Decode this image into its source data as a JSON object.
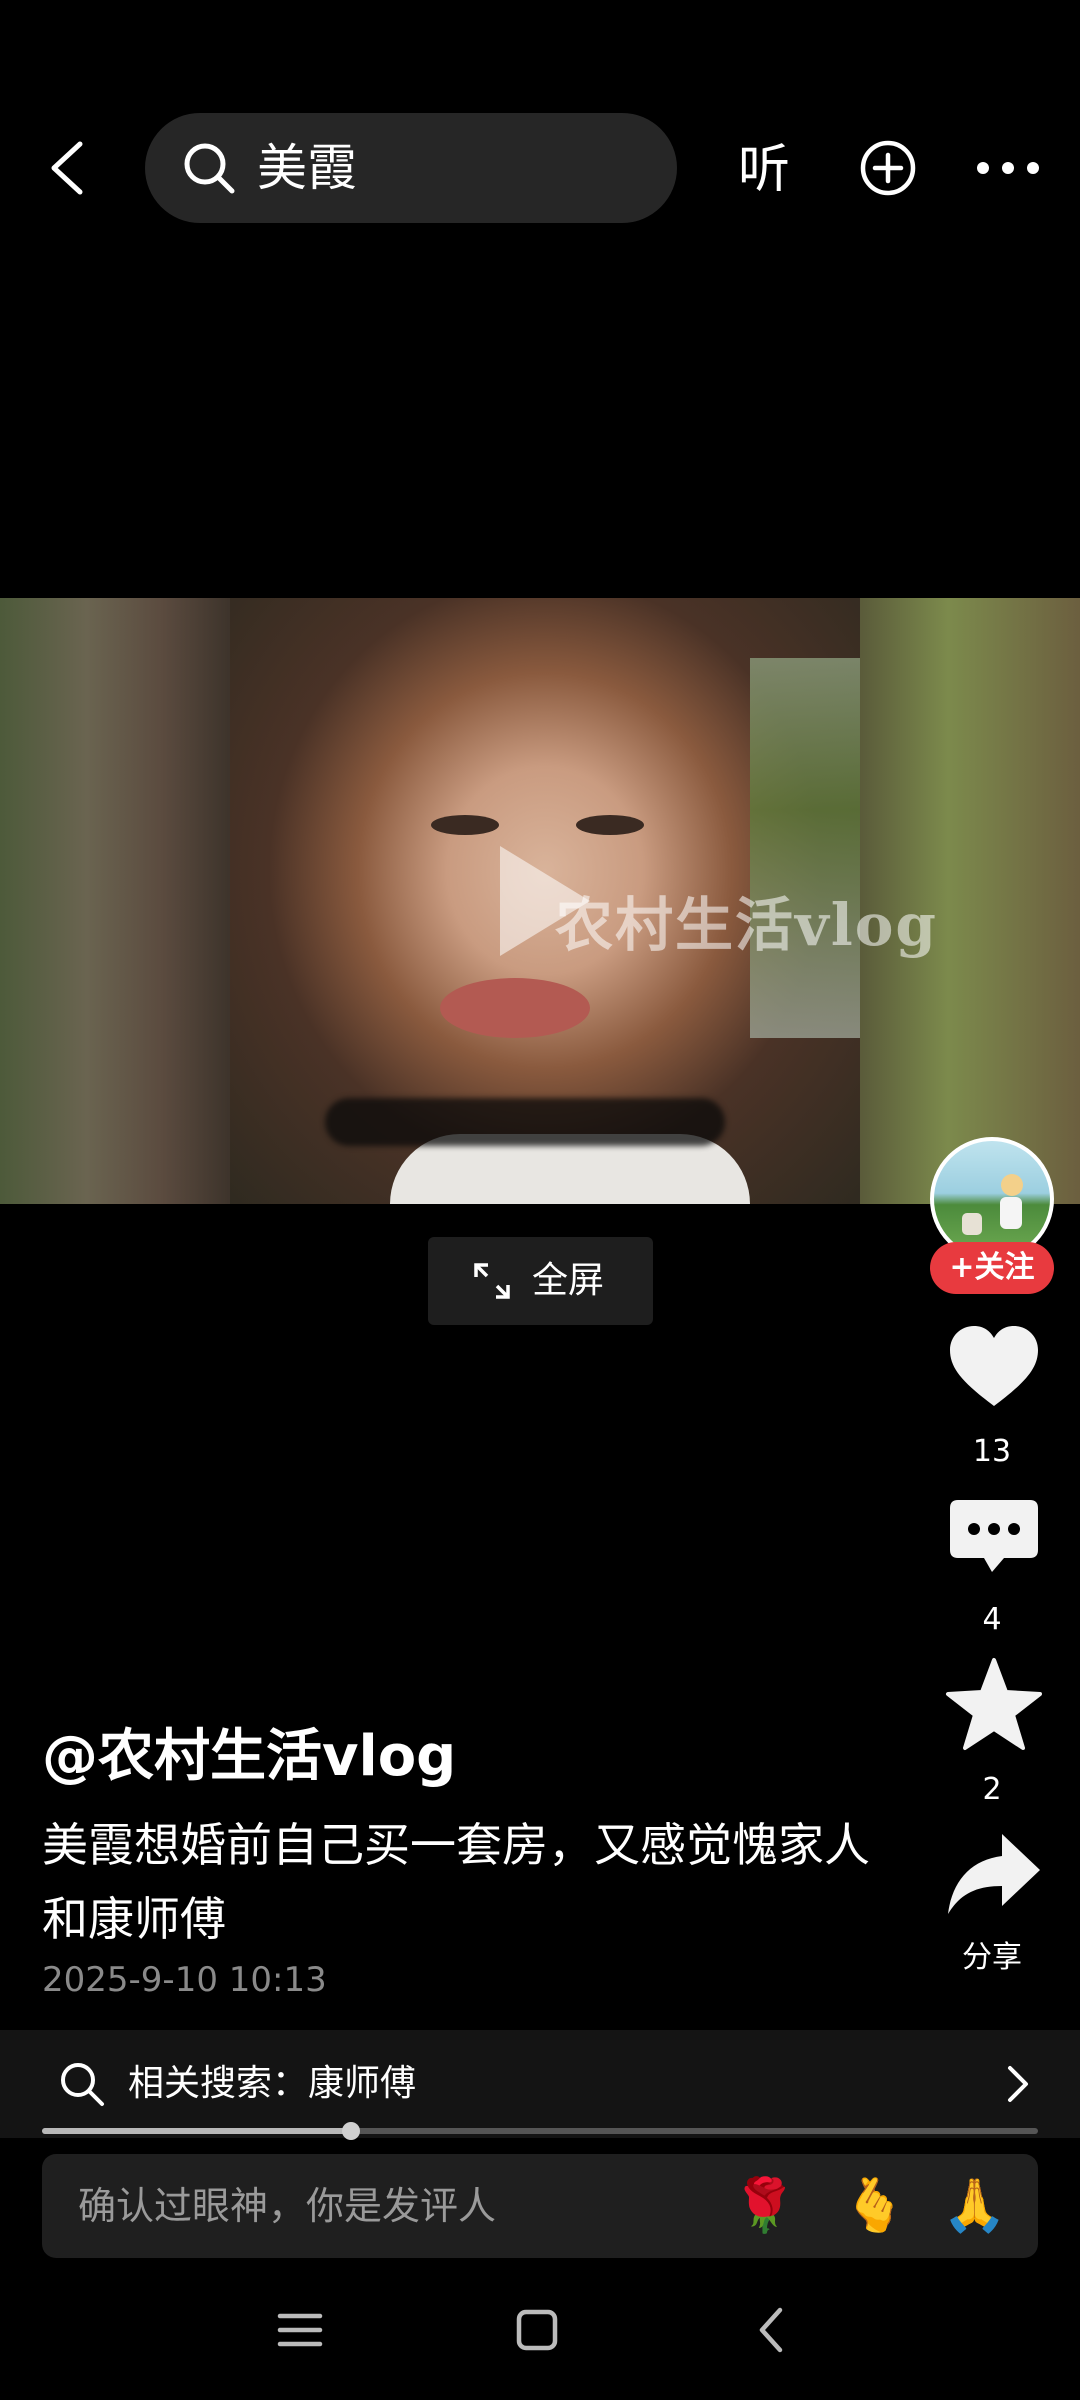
{
  "top_bar": {
    "search_query": "美霞",
    "listen_label": "听"
  },
  "video": {
    "watermark": "农村生活vlog",
    "fullscreen_label": "全屏"
  },
  "side_actions": {
    "follow_label": "+关注",
    "like_count": "13",
    "comment_count": "4",
    "favorite_count": "2",
    "share_label": "分享"
  },
  "post": {
    "author": "@农村生活vlog",
    "description": "美霞想婚前自己买一套房，又感觉愧家人和康师傅",
    "datetime": "2025-9-10 10:13"
  },
  "related_search": {
    "label": "相关搜索：康师傅"
  },
  "playback": {
    "progress": 0.31
  },
  "comment_bar": {
    "placeholder": "确认过眼神，你是发评人",
    "emojis": [
      "🌹",
      "🫰",
      "🙏"
    ]
  },
  "icons": [
    "back-arrow-icon",
    "search-icon",
    "add-circle-icon",
    "more-dots-icon",
    "play-icon",
    "expand-icon",
    "heart-icon",
    "comment-bubble-icon",
    "star-icon",
    "share-arrow-icon",
    "chevron-right-icon",
    "menu-icon",
    "home-square-icon",
    "nav-back-icon"
  ],
  "colors": {
    "follow_red": "#e83a3f",
    "background": "#000000",
    "search_bg": "#262626"
  }
}
